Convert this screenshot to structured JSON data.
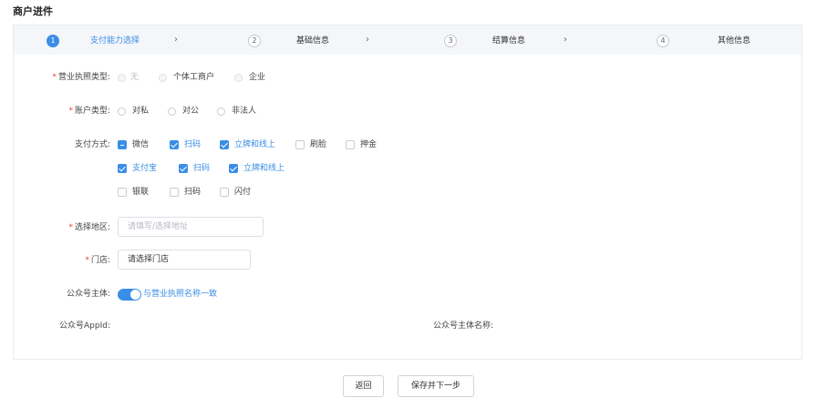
{
  "page": {
    "title": "商户进件"
  },
  "steps": [
    {
      "num": "1",
      "label": "支付能力选择",
      "active": true
    },
    {
      "num": "2",
      "label": "基础信息",
      "active": false
    },
    {
      "num": "3",
      "label": "结算信息",
      "active": false
    },
    {
      "num": "4",
      "label": "其他信息",
      "active": false
    }
  ],
  "step_arrow": "›",
  "form": {
    "license_type": {
      "label": "营业执照类型:",
      "options": [
        "无",
        "个体工商户",
        "企业"
      ]
    },
    "account_type": {
      "label": "账户类型:",
      "options": [
        "对私",
        "对公",
        "非法人"
      ]
    },
    "payment_methods": {
      "label": "支付方式:",
      "wechat": {
        "label": "微信",
        "items": [
          "扫码",
          "立牌和线上",
          "刷脸",
          "押金"
        ]
      },
      "alipay": {
        "label": "支付宝",
        "items": [
          "扫码",
          "立牌和线上"
        ]
      },
      "unionpay": {
        "label": "银联",
        "items": [
          "扫码",
          "闪付"
        ]
      }
    },
    "region": {
      "label": "选择地区:",
      "placeholder": "请填写/选择地址"
    },
    "store": {
      "label": "门店:",
      "value": "请选择门店"
    },
    "official_account": {
      "label": "公众号主体:",
      "switch_text": "与营业执照名称一致"
    },
    "appid": {
      "label": "公众号AppId:"
    },
    "subject_name": {
      "label": "公众号主体名称:"
    }
  },
  "required_mark": "*",
  "buttons": {
    "back": "返回",
    "save_next": "保存并下一步"
  },
  "colors": {
    "accent": "#3a8ee6",
    "required": "#e64340"
  }
}
